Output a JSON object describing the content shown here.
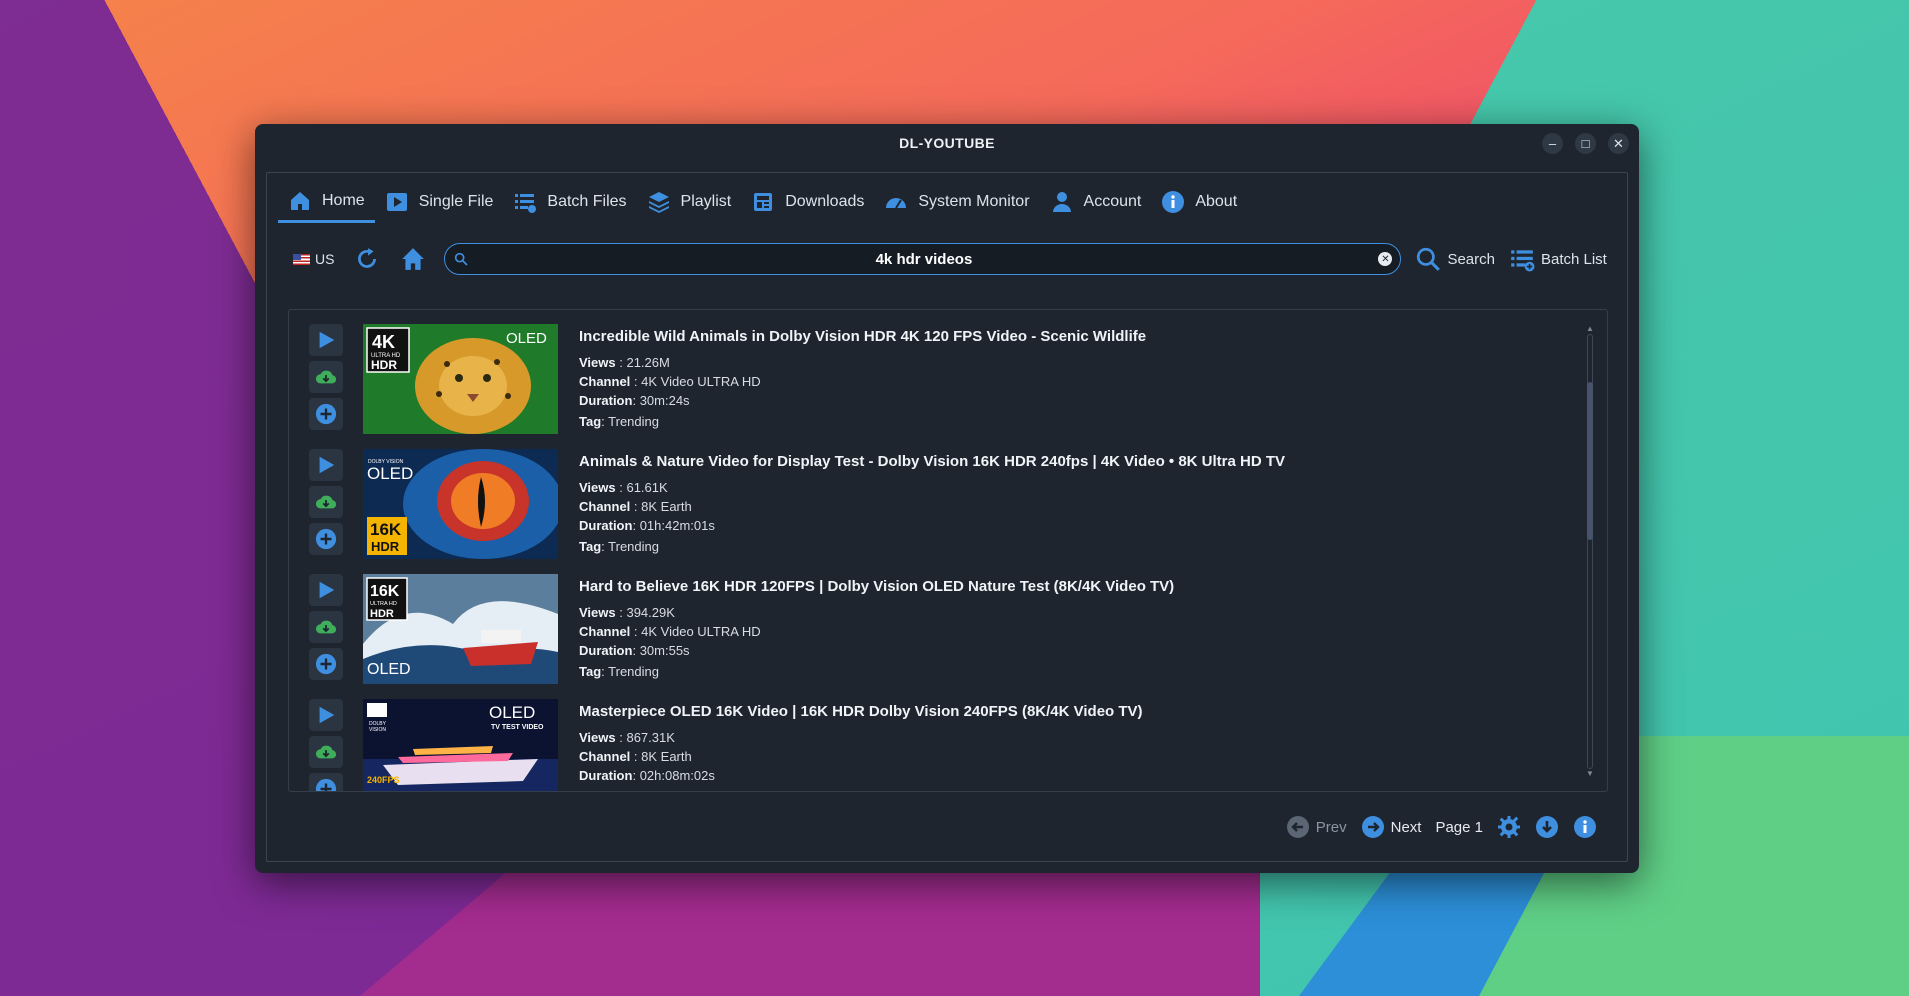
{
  "window": {
    "title": "DL-YOUTUBE",
    "controls": [
      "–",
      "□",
      "✕"
    ]
  },
  "tabs": [
    {
      "label": "Home",
      "icon": "home-icon",
      "active": true
    },
    {
      "label": "Single File",
      "icon": "play-icon",
      "active": false
    },
    {
      "label": "Batch Files",
      "icon": "list-add-icon",
      "active": false
    },
    {
      "label": "Playlist",
      "icon": "stack-icon",
      "active": false
    },
    {
      "label": "Downloads",
      "icon": "newspaper-icon",
      "active": false
    },
    {
      "label": "System Monitor",
      "icon": "gauge-icon",
      "active": false
    },
    {
      "label": "Account",
      "icon": "user-icon",
      "active": false
    },
    {
      "label": "About",
      "icon": "info-icon",
      "active": false
    }
  ],
  "toolbar": {
    "locale": "US",
    "search_value": "4k hdr videos",
    "search_label": "Search",
    "batch_label": "Batch List"
  },
  "videos": [
    {
      "title": "Incredible Wild Animals in Dolby Vision HDR 4K 120 FPS Video - Scenic Wildlife",
      "views": "21.26M",
      "channel": "4K Video ULTRA HD",
      "duration": "30m:24s",
      "tag": "Trending",
      "thumb_badges": [
        "4K",
        "ULTRA HD",
        "HDR",
        "OLED"
      ]
    },
    {
      "title": "Animals & Nature Video for Display Test - Dolby Vision 16K HDR 240fps | 4K Video • 8K Ultra HD TV",
      "views": "61.61K",
      "channel": "8K Earth",
      "duration": "01h:42m:01s",
      "tag": "Trending",
      "thumb_badges": [
        "OLED",
        "16K",
        "HDR"
      ]
    },
    {
      "title": "Hard to Believe 16K HDR 120FPS | Dolby Vision OLED Nature Test (8K/4K Video TV)",
      "views": "394.29K",
      "channel": "4K Video ULTRA HD",
      "duration": "30m:55s",
      "tag": "Trending",
      "thumb_badges": [
        "16K",
        "ULTRA HD",
        "HDR",
        "OLED"
      ]
    },
    {
      "title": "Masterpiece OLED 16K Video | 16K HDR Dolby Vision 240FPS (8K/4K Video TV)",
      "views": "867.31K",
      "channel": "8K Earth",
      "duration": "02h:08m:02s",
      "tag": "",
      "thumb_badges": [
        "OLED",
        "TV TEST VIDEO",
        "240FPS"
      ]
    }
  ],
  "labels": {
    "views": "Views",
    "channel": "Channel",
    "duration": "Duration",
    "tag": "Tag",
    "sep": " : ",
    "sep2": ": "
  },
  "pager": {
    "prev": "Prev",
    "next": "Next",
    "page": "Page 1"
  },
  "colors": {
    "accent": "#3f8fe0",
    "download": "#3fae5a",
    "bg": "#1e252f"
  }
}
